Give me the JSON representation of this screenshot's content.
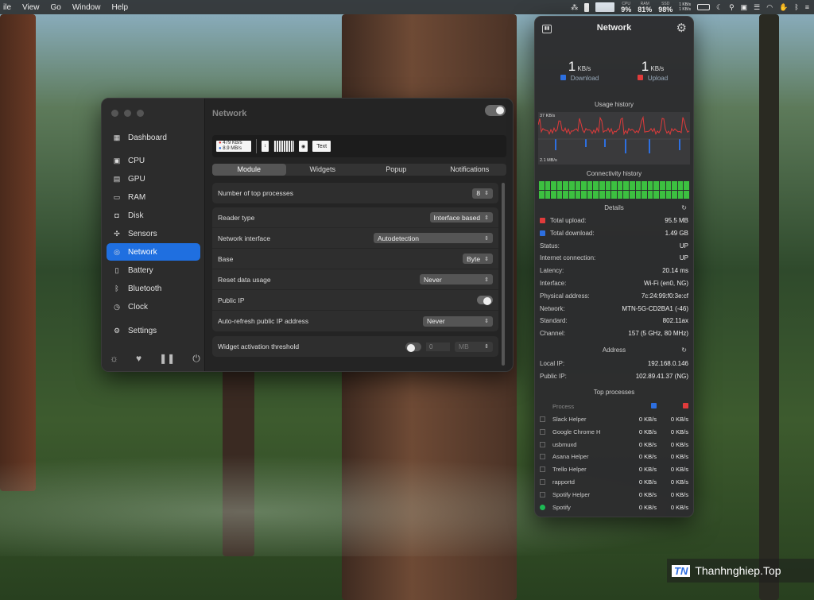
{
  "menubar": {
    "menus": [
      "ile",
      "View",
      "Go",
      "Window",
      "Help"
    ],
    "stats": [
      {
        "label": "CPU",
        "value": "9%"
      },
      {
        "label": "RAM",
        "value": "81%"
      },
      {
        "label": "SSD",
        "value": "98%"
      }
    ],
    "net_up": "1 KB/s",
    "net_down": "1 KB/s"
  },
  "window": {
    "title": "Network",
    "sidebar": [
      {
        "label": "Dashboard",
        "icon": "grid-icon"
      },
      {
        "label": "CPU",
        "icon": "cpu-icon"
      },
      {
        "label": "GPU",
        "icon": "gpu-icon"
      },
      {
        "label": "RAM",
        "icon": "ram-icon"
      },
      {
        "label": "Disk",
        "icon": "disk-icon"
      },
      {
        "label": "Sensors",
        "icon": "fan-icon"
      },
      {
        "label": "Network",
        "icon": "globe-icon"
      },
      {
        "label": "Battery",
        "icon": "battery-icon"
      },
      {
        "label": "Bluetooth",
        "icon": "bluetooth-icon"
      },
      {
        "label": "Clock",
        "icon": "clock-icon"
      },
      {
        "label": "Settings",
        "icon": "gear-icon"
      }
    ],
    "preview": {
      "up": "479 KB/s",
      "down": "8.9 MB/s",
      "text_widget": "Text"
    },
    "tabs": [
      "Module",
      "Widgets",
      "Popup",
      "Notifications"
    ],
    "active_tab": "Module",
    "settings": {
      "top_processes_label": "Number of top processes",
      "top_processes_value": "8",
      "reader_type_label": "Reader type",
      "reader_type_value": "Interface based",
      "network_interface_label": "Network interface",
      "network_interface_value": "Autodetection",
      "base_label": "Base",
      "base_value": "Byte",
      "reset_label": "Reset data usage",
      "reset_value": "Never",
      "public_ip_label": "Public IP",
      "auto_refresh_label": "Auto-refresh public IP address",
      "auto_refresh_value": "Never",
      "threshold_label": "Widget activation threshold",
      "threshold_value": "0",
      "threshold_unit": "MB"
    }
  },
  "popup": {
    "title": "Network",
    "download_value": "1",
    "download_unit": "KB/s",
    "download_label": "Download",
    "upload_value": "1",
    "upload_unit": "KB/s",
    "upload_label": "Upload",
    "usage_history_label": "Usage history",
    "usage_max": "37 KB/s",
    "usage_min": "2.1 MB/s",
    "connectivity_label": "Connectivity history",
    "details_label": "Details",
    "details": [
      {
        "key": "Total upload:",
        "value": "95.5 MB",
        "color": "#e03b3b"
      },
      {
        "key": "Total download:",
        "value": "1.49 GB",
        "color": "#2d6fe0"
      },
      {
        "key": "Status:",
        "value": "UP"
      },
      {
        "key": "Internet connection:",
        "value": "UP"
      },
      {
        "key": "Latency:",
        "value": "20.14 ms"
      },
      {
        "key": "Interface:",
        "value": "Wi-Fi (en0, NG)"
      },
      {
        "key": "Physical address:",
        "value": "7c:24:99:f0:3e:cf"
      },
      {
        "key": "Network:",
        "value": "MTN-5G-CD2BA1 (-46)"
      },
      {
        "key": "Standard:",
        "value": "802.11ax"
      },
      {
        "key": "Channel:",
        "value": "157 (5 GHz, 80 MHz)"
      }
    ],
    "address_label": "Address",
    "address": [
      {
        "key": "Local IP:",
        "value": "192.168.0.146"
      },
      {
        "key": "Public IP:",
        "value": "102.89.41.37 (NG)"
      }
    ],
    "top_processes_label": "Top processes",
    "process_header": "Process",
    "processes": [
      {
        "name": "Slack Helper",
        "down": "0 KB/s",
        "up": "0 KB/s"
      },
      {
        "name": "Google Chrome H",
        "down": "0 KB/s",
        "up": "0 KB/s"
      },
      {
        "name": "usbmuxd",
        "down": "0 KB/s",
        "up": "0 KB/s"
      },
      {
        "name": "Asana Helper",
        "down": "0 KB/s",
        "up": "0 KB/s"
      },
      {
        "name": "Trello Helper",
        "down": "0 KB/s",
        "up": "0 KB/s"
      },
      {
        "name": "rapportd",
        "down": "0 KB/s",
        "up": "0 KB/s"
      },
      {
        "name": "Spotify Helper",
        "down": "0 KB/s",
        "up": "0 KB/s"
      },
      {
        "name": "Spotify",
        "down": "0 KB/s",
        "up": "0 KB/s"
      }
    ]
  },
  "watermark": {
    "badge": "TN",
    "text": "Thanhnghiep.Top"
  },
  "colors": {
    "accent": "#1f6fe0",
    "download": "#2d6fe0",
    "upload": "#e03b3b",
    "connectivity": "#3cc040"
  }
}
